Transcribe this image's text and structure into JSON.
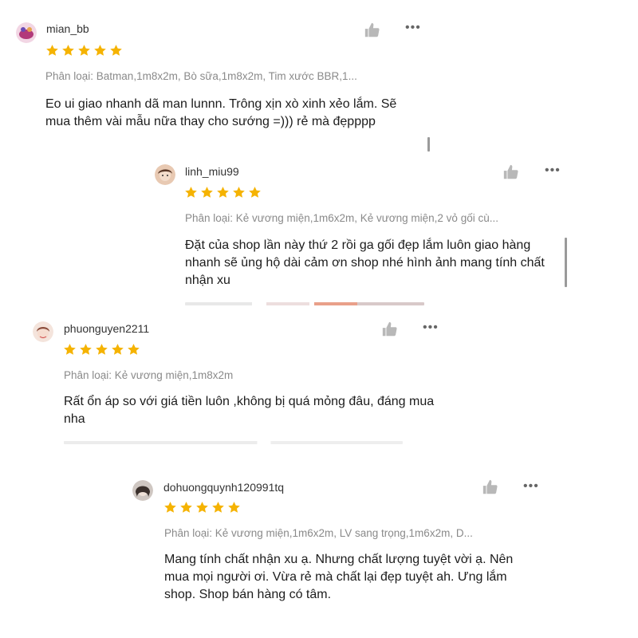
{
  "reviews": [
    {
      "username": "mian_bb",
      "rating": 5,
      "variant": "Phân loại: Batman,1m8x2m, Bò sữa,1m8x2m, Tim xước BBR,1...",
      "comment": "Eo ui giao nhanh dã man lunnn. Trông xịn xò xinh xẻo lắm. Sẽ mua thêm vài mẫu nữa thay cho sướng =))) rẻ mà đẹpppp"
    },
    {
      "username": "linh_miu99",
      "rating": 5,
      "variant": "Phân loại: Kẻ vương miện,1m6x2m, Kẻ vương miện,2 vỏ gối cù...",
      "comment": "Đặt của shop lần này thứ 2 rồi ga gối đẹp lắm luôn giao hàng nhanh sẽ ủng hộ dài cảm ơn shop nhé hình ảnh mang tính chất nhận xu"
    },
    {
      "username": "phuonguyen2211",
      "rating": 5,
      "variant": "Phân loại: Kẻ vương miện,1m8x2m",
      "comment": "Rất ổn áp so với giá tiền luôn ,không bị quá mỏng đâu, đáng mua nha"
    },
    {
      "username": "dohuongquynh120991tq",
      "rating": 5,
      "variant": "Phân loại: Kẻ vương miện,1m6x2m, LV sang trọng,1m6x2m, D...",
      "comment": "Mang tính chất nhận xu ạ. Nhưng chất lượng tuyệt vời ạ. Nên mua mọi người ơi. Vừa rẻ mà chất lại đẹp tuyệt ah. Ưng lắm shop. Shop bán hàng có tâm."
    }
  ],
  "colors": {
    "star": "#f5b301",
    "like_icon": "#b8b8b8"
  },
  "icons": {
    "like": "thumbs-up-icon",
    "more": "more-dots-icon",
    "star": "star-icon"
  }
}
